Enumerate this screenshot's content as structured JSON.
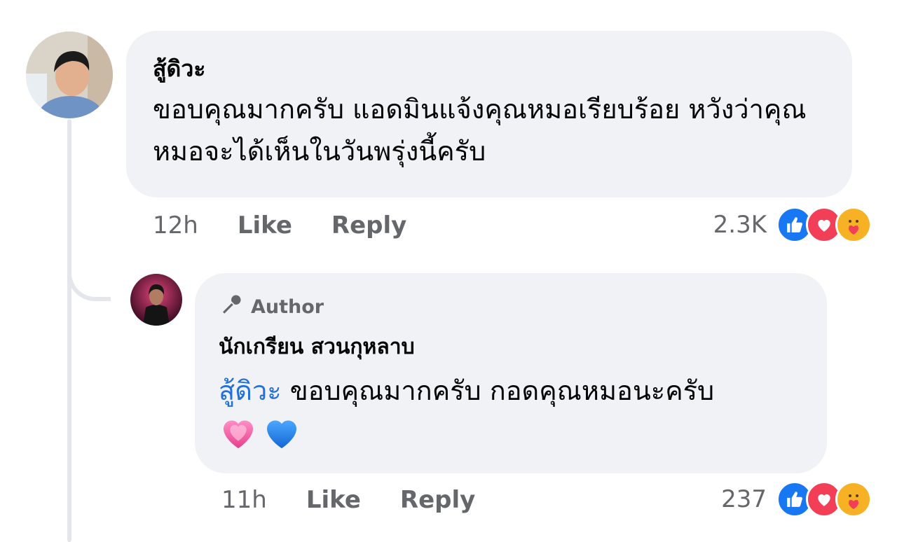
{
  "comment": {
    "author": "สู้ดิวะ",
    "text": "ขอบคุณมากครับ แอดมินแจ้งคุณหมอเรียบร้อย หวังว่าคุณหมอจะได้เห็นในวันพรุ่งนี้ครับ",
    "time": "12h",
    "like_label": "Like",
    "reply_label": "Reply",
    "reaction_count": "2.3K",
    "reactions": [
      "like-icon",
      "love-icon",
      "care-icon"
    ]
  },
  "reply": {
    "badge": "Author",
    "badge_icon": "microphone-icon",
    "author": "นักเกรียน สวนกุหลาบ",
    "mention": "สู้ดิวะ",
    "text": " ขอบคุณมากครับ  กอดคุณหมอนะครับ",
    "emojis": [
      "pink-heart-emoji",
      "blue-heart-emoji"
    ],
    "time": "11h",
    "like_label": "Like",
    "reply_label": "Reply",
    "reaction_count": "237",
    "reactions": [
      "like-icon",
      "love-icon",
      "care-icon"
    ]
  },
  "colors": {
    "bubble": "#f0f2f5",
    "secondary_text": "#65676b",
    "mention": "#216fdb",
    "like": "#1877f2",
    "love": "#f33e58",
    "care": "#f7b125"
  }
}
